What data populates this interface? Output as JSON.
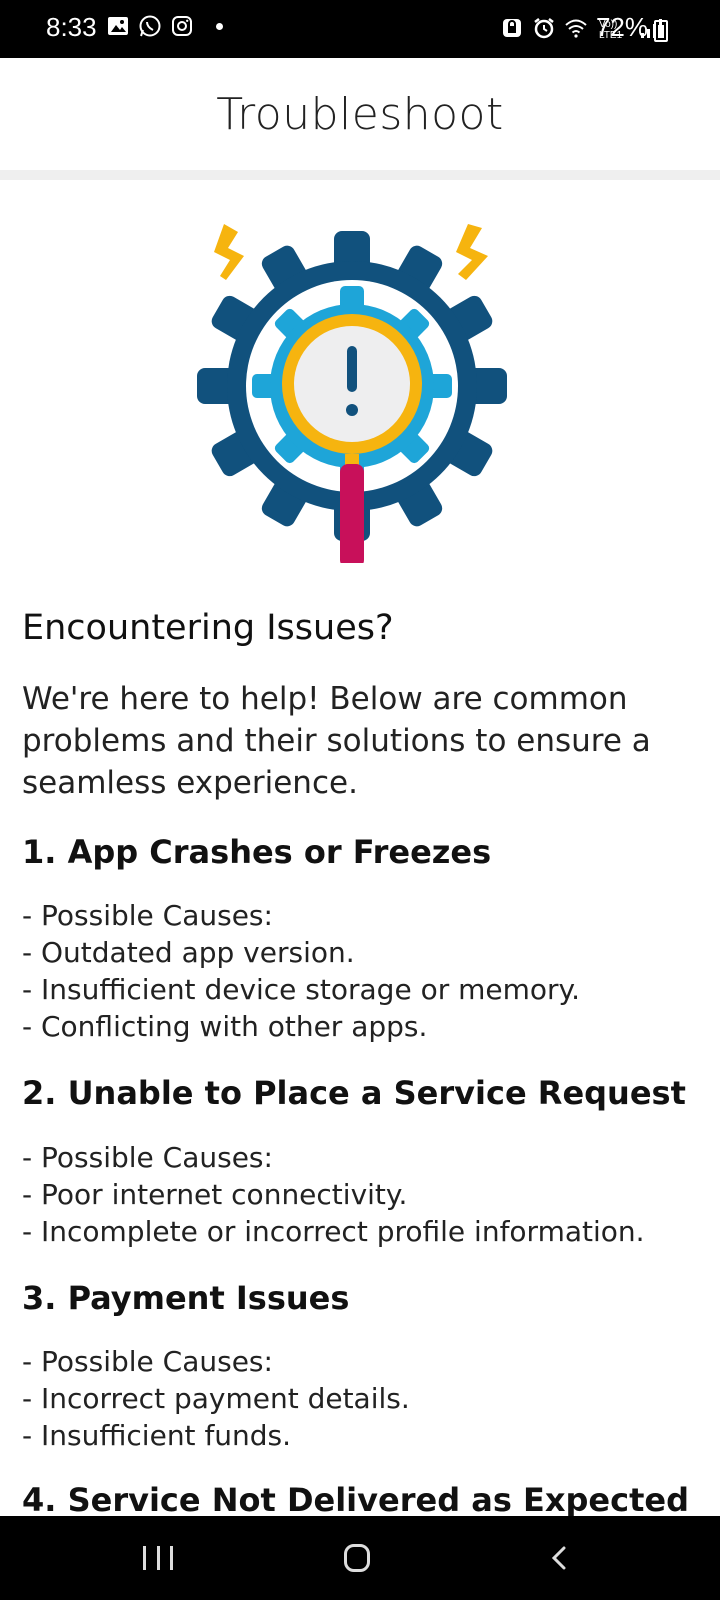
{
  "status_bar": {
    "time": "8:33",
    "battery": "72%",
    "icons_left": [
      "gallery-icon",
      "whatsapp-icon",
      "instagram-icon",
      "notification-dot"
    ],
    "icons_right": [
      "vpn-icon",
      "alarm-icon",
      "wifi-icon",
      "volte-lte-icon",
      "signal-icon",
      "battery-icon"
    ]
  },
  "header": {
    "title": "Troubleshoot"
  },
  "illustration": {
    "icon": "gear-magnifier-alert-icon",
    "colors": {
      "gear": "#11517d",
      "inner_gear": "#1ea5d8",
      "ring": "#f6b40f",
      "handle": "#c8105a",
      "bolt": "#f6b40f"
    }
  },
  "intro": {
    "title": "Encountering Issues?",
    "text": "We're here to help! Below are common problems and their solutions to ensure a seamless experience."
  },
  "sections": [
    {
      "title": "1. App Crashes or Freezes",
      "items": [
        "- Possible Causes:",
        "- Outdated app version.",
        "- Insufficient device storage or memory.",
        "- Conflicting with other apps."
      ]
    },
    {
      "title": "2. Unable to Place a Service Request",
      "items": [
        "- Possible Causes:",
        "- Poor internet connectivity.",
        "- Incomplete or incorrect profile information."
      ]
    },
    {
      "title": "3. Payment Issues",
      "items": [
        "- Possible Causes:",
        "- Incorrect payment details.",
        "- Insufficient funds."
      ]
    }
  ],
  "cutoff_section": {
    "title": "4. Service Not Delivered as Expected"
  },
  "nav_bar": {
    "buttons": [
      "recent-apps-icon",
      "home-icon",
      "back-icon"
    ]
  }
}
